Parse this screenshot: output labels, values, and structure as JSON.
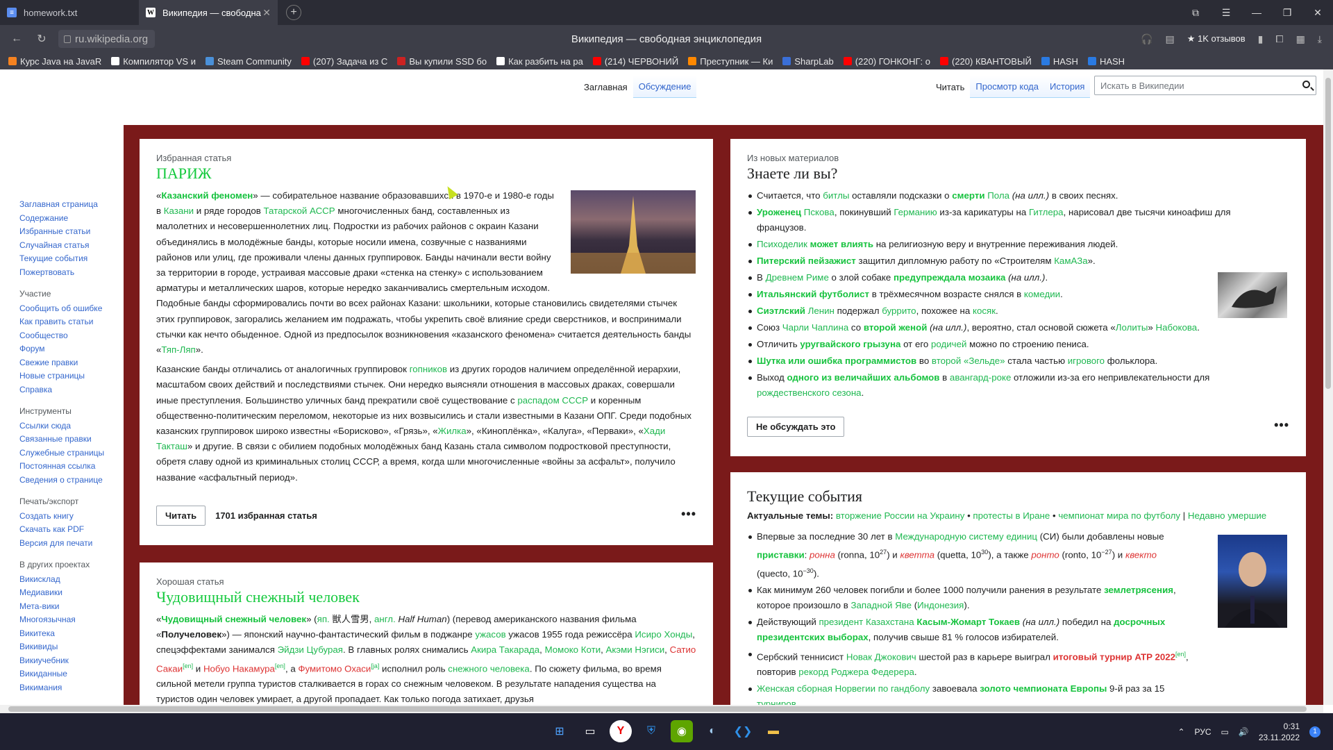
{
  "browser": {
    "tabs": [
      {
        "title": "homework.txt",
        "icon": "file-icon"
      },
      {
        "title": "Википедия — свободна",
        "icon": "wikipedia-icon"
      }
    ],
    "url": "ru.wikipedia.org",
    "page_title": "Википедия — свободная энциклопедия",
    "reviews": "★ 1K отзывов",
    "bookmarks": [
      {
        "label": "Курс Java на JavaR",
        "color": "#f58220"
      },
      {
        "label": "Компилятор VS и",
        "color": "#ffffff"
      },
      {
        "label": "Steam Community",
        "color": "#4a90d9"
      },
      {
        "label": "(207) Задача из С",
        "color": "#ff0000"
      },
      {
        "label": "Вы купили SSD бо",
        "color": "#cc2222"
      },
      {
        "label": "Как разбить на ра",
        "color": "#ffffff"
      },
      {
        "label": "(214) ЧЕРВОНИЙ",
        "color": "#ff0000"
      },
      {
        "label": "Преступник — Ки",
        "color": "#ff8800"
      },
      {
        "label": "SharpLab",
        "color": "#3a6fd8"
      },
      {
        "label": "(220) ГОНКОНГ: о",
        "color": "#ff0000"
      },
      {
        "label": "(220) КВАНТОВЫЙ",
        "color": "#ff0000"
      },
      {
        "label": "HASH",
        "color": "#2a7ae2"
      },
      {
        "label": "HASH",
        "color": "#2a7ae2"
      }
    ]
  },
  "wiki": {
    "tabs_left": [
      "Заглавная",
      "Обсуждение"
    ],
    "tabs_right": [
      "Читать",
      "Просмотр кода",
      "История"
    ],
    "search_placeholder": "Искать в Википедии",
    "sidebar": {
      "main": [
        "Заглавная страница",
        "Содержание",
        "Избранные статьи",
        "Случайная статья",
        "Текущие события",
        "Пожертвовать"
      ],
      "participation_title": "Участие",
      "participation": [
        "Сообщить об ошибке",
        "Как править статьи",
        "Сообщество",
        "Форум",
        "Свежие правки",
        "Новые страницы",
        "Справка"
      ],
      "tools_title": "Инструменты",
      "tools": [
        "Ссылки сюда",
        "Связанные правки",
        "Служебные страницы",
        "Постоянная ссылка",
        "Сведения о странице"
      ],
      "print_title": "Печать/экспорт",
      "print": [
        "Создать книгу",
        "Скачать как PDF",
        "Версия для печати"
      ],
      "projects_title": "В других проектах",
      "projects": [
        "Викисклад",
        "Медиавики",
        "Мета-вики",
        "Многоязычная Викитека",
        "Викивиды",
        "Викиучебник",
        "Викиданные",
        "Викимания"
      ]
    },
    "featured": {
      "kicker": "Избранная статья",
      "title": "ПАРИЖ",
      "read_button": "Читать",
      "count": "1701 избранная статья"
    },
    "good": {
      "kicker": "Хорошая статья",
      "title": "Чудовищный снежный человек"
    },
    "dyk": {
      "kicker": "Из новых материалов",
      "title": "Знаете ли вы?",
      "button": "Не обсуждать это"
    },
    "news": {
      "title": "Текущие события",
      "topics_label": "Актуальные темы:"
    }
  },
  "taskbar": {
    "lang": "РУС",
    "time": "0:31",
    "date": "23.11.2022",
    "notifications": "1"
  }
}
